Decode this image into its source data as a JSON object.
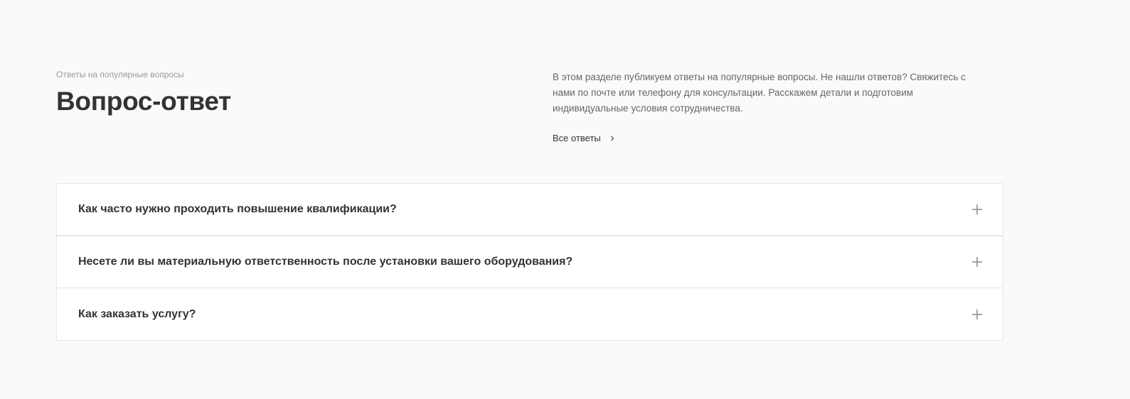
{
  "header": {
    "subtitle": "Ответы на популярные вопросы",
    "title": "Вопрос-ответ"
  },
  "intro": {
    "text": "В этом разделе публикуем ответы на популярные вопросы. Не нашли ответов? Свяжитесь с нами по почте или телефону для консультации. Расскажем детали и подготовим индивидуальные условия сотрудничества.",
    "all_link_label": "Все ответы",
    "all_link_icon": "chevron-right-icon"
  },
  "faq": {
    "items": [
      {
        "question": "Как часто нужно проходить повышение квалификации?",
        "icon": "plus-icon"
      },
      {
        "question": "Несете ли вы материальную ответственность после установки вашего оборудования?",
        "icon": "plus-icon"
      },
      {
        "question": "Как заказать услугу?",
        "icon": "plus-icon"
      }
    ]
  },
  "colors": {
    "background": "#fafafa",
    "card": "#ffffff",
    "border": "#e5e5e5",
    "text": "#333333",
    "muted": "#999999"
  }
}
